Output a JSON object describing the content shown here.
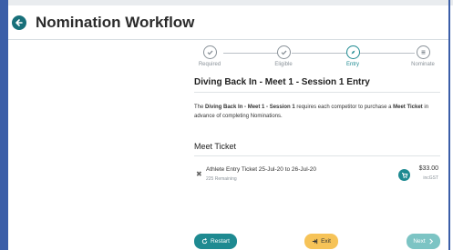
{
  "header": {
    "title": "Nomination Workflow"
  },
  "steps": [
    {
      "label": "Required",
      "icon": "check-circle-icon",
      "state": "done"
    },
    {
      "label": "Eligible",
      "icon": "check-circle-icon",
      "state": "done"
    },
    {
      "label": "Entry",
      "icon": "compass-icon",
      "state": "active"
    },
    {
      "label": "Nominate",
      "icon": "list-icon",
      "state": "pending"
    }
  ],
  "panel": {
    "title": "Diving Back In - Meet 1 - Session 1 Entry",
    "desc_pre": "The ",
    "desc_bold1": "Diving Back In - Meet 1 - Session 1",
    "desc_mid": " requires each competitor to purchase a ",
    "desc_bold2": "Meet Ticket",
    "desc_post": " in advance of completing Nominations."
  },
  "ticket_section": {
    "title": "Meet Ticket",
    "item": {
      "name": "Athlete Entry Ticket 25-Jul-20 to 26-Jul-20",
      "remaining": "225 Remaining",
      "price": "$33.00",
      "tax": "incGST"
    }
  },
  "actions": {
    "restart": "Restart",
    "exit": "Exit",
    "next": "Next"
  },
  "colors": {
    "accent": "#1e8a91",
    "exit": "#f6c358",
    "next_disabled": "#7cc4c4",
    "frame": "#3b5ea8"
  }
}
